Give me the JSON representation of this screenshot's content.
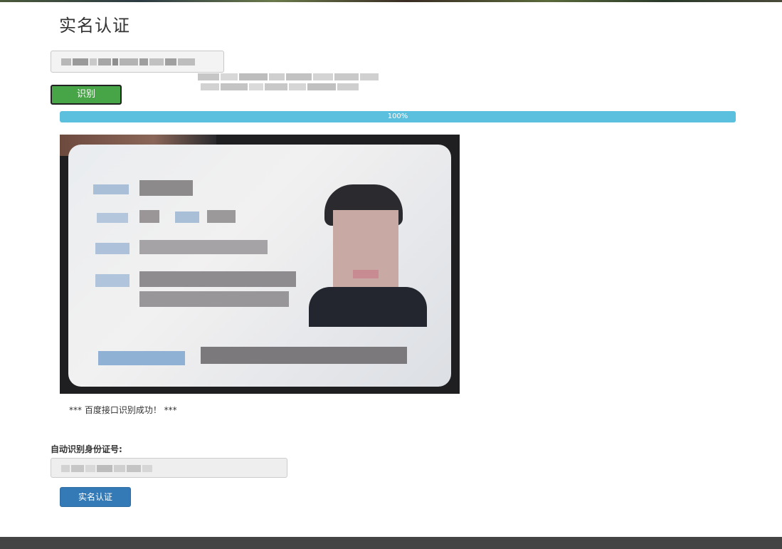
{
  "page": {
    "title": "实名认证"
  },
  "upload": {
    "file_input_value": "",
    "filename": ""
  },
  "recognize_button": {
    "label": "识别"
  },
  "progress": {
    "label": "100%",
    "value": 1.0,
    "color": "#5bc0de"
  },
  "id_photo": {
    "icon": "id-card-photo"
  },
  "status": {
    "message": "*** 百度接口识别成功！ ***"
  },
  "id_field": {
    "label": "自动识别身份证号:",
    "value": ""
  },
  "verify_button": {
    "label": "实名认证",
    "color": "#337ab7"
  },
  "colors": {
    "success_button": "#47a447",
    "footer": "#444444"
  }
}
